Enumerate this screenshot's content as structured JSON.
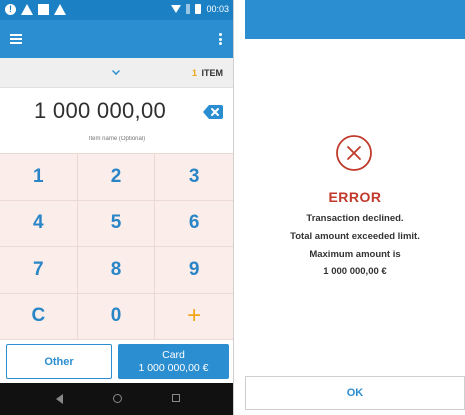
{
  "status_bar": {
    "time": "00:03",
    "left_icons": [
      "info-icon",
      "warning-icon",
      "square-notification-icon",
      "warning-icon"
    ],
    "right_icons": [
      "wifi-icon",
      "signal-icon",
      "battery-icon"
    ]
  },
  "app_bar": {
    "color": "#2b8ed1",
    "menu_icon": "hamburger-menu-icon",
    "overflow_icon": "kebab-menu-icon"
  },
  "items_bar": {
    "count": "1",
    "label": "ITEM",
    "count_color": "#f2a516"
  },
  "amount": {
    "value": "1 000 000,00",
    "backspace_icon": "backspace-icon"
  },
  "item_name": {
    "placeholder": "Item name (Optional)"
  },
  "keypad": {
    "keys": [
      "1",
      "2",
      "3",
      "4",
      "5",
      "6",
      "7",
      "8",
      "9",
      "C",
      "0",
      "+"
    ]
  },
  "actions": {
    "other_label": "Other",
    "card_label": "Card",
    "card_amount": "1 000 000,00 €"
  },
  "nav_bar": {
    "icons": [
      "back-icon",
      "home-icon",
      "recents-icon"
    ]
  },
  "error_dialog": {
    "title": "ERROR",
    "title_color": "#c0392b",
    "lines": [
      "Transaction declined.",
      "Total amount exceeded limit.",
      "Maximum amount is",
      "1 000 000,00 €"
    ],
    "ok_label": "OK"
  }
}
